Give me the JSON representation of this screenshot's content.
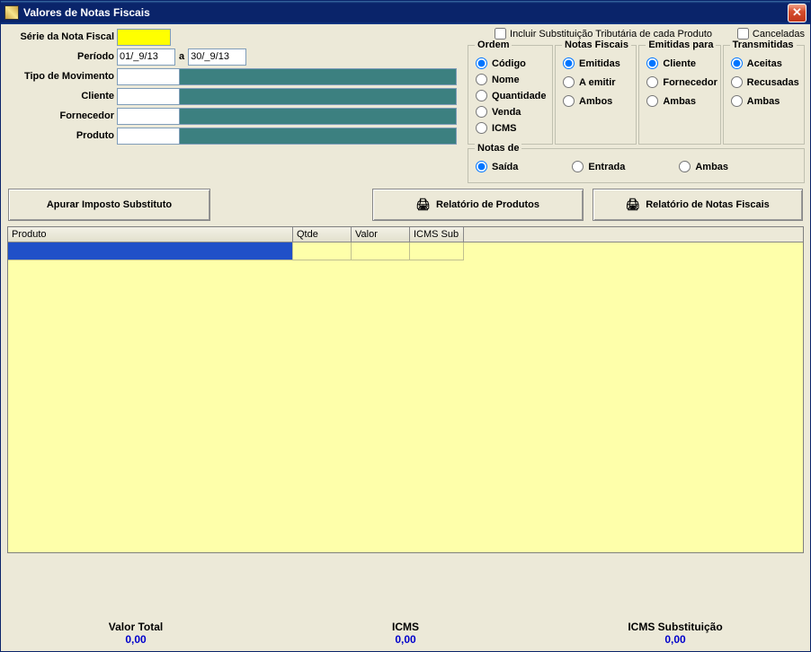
{
  "window": {
    "title": "Valores de Notas Fiscais"
  },
  "form": {
    "serie_label": "Série da Nota Fiscal",
    "serie_value": "",
    "periodo_label": "Período",
    "periodo_from": "01/_9/13",
    "periodo_sep": "a",
    "periodo_to": "30/_9/13",
    "tipo_label": "Tipo de Movimento",
    "tipo_value": "",
    "cliente_label": "Cliente",
    "cliente_value": "",
    "fornecedor_label": "Fornecedor",
    "fornecedor_value": "",
    "produto_label": "Produto",
    "produto_value": ""
  },
  "checks": {
    "incluir_sub": "Incluir Substituição Tributária de cada Produto",
    "canceladas": "Canceladas"
  },
  "groups": {
    "ordem": {
      "legend": "Ordem",
      "codigo": "Código",
      "nome": "Nome",
      "quantidade": "Quantidade",
      "venda": "Venda",
      "icms": "ICMS"
    },
    "notas": {
      "legend": "Notas Fiscais",
      "emitidas": "Emitidas",
      "aemitir": "A emitir",
      "ambos": "Ambos"
    },
    "emitidas_para": {
      "legend": "Emitidas para",
      "cliente": "Cliente",
      "fornecedor": "Fornecedor",
      "ambas": "Ambas"
    },
    "transmitidas": {
      "legend": "Transmitidas",
      "aceitas": "Aceitas",
      "recusadas": "Recusadas",
      "ambas": "Ambas"
    },
    "notas_de": {
      "legend": "Notas de",
      "saida": "Saída",
      "entrada": "Entrada",
      "ambas": "Ambas"
    }
  },
  "buttons": {
    "apurar": "Apurar Imposto Substituto",
    "rel_produtos": "Relatório de Produtos",
    "rel_notas": "Relatório de Notas Fiscais"
  },
  "grid": {
    "headers": {
      "produto": "Produto",
      "qtde": "Qtde",
      "valor": "Valor",
      "icms": "ICMS Sub"
    }
  },
  "footer": {
    "total_label": "Valor Total",
    "total_value": "0,00",
    "icms_label": "ICMS",
    "icms_value": "0,00",
    "icmssub_label": "ICMS Substituição",
    "icmssub_value": "0,00"
  }
}
